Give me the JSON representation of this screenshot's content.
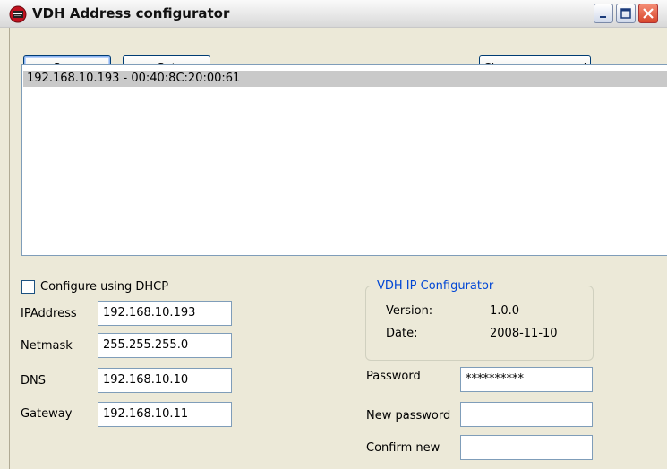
{
  "window": {
    "title": "VDH Address configurator"
  },
  "toolbar": {
    "scan_label": "Scan",
    "set_label": "Set",
    "change_password_label": "Change password"
  },
  "devices": [
    "192.168.10.193 - 00:40:8C:20:00:61"
  ],
  "network": {
    "dhcp_label": "Configure using DHCP",
    "dhcp_checked": false,
    "ip_label": "IPAddress",
    "ip_value": "192.168.10.193",
    "netmask_label": "Netmask",
    "netmask_value": "255.255.255.0",
    "dns_label": "DNS",
    "dns_value": "192.168.10.10",
    "gateway_label": "Gateway",
    "gateway_value": "192.168.10.11"
  },
  "about": {
    "title": "VDH IP Configurator",
    "version_label": "Version:",
    "version_value": "1.0.0",
    "date_label": "Date:",
    "date_value": "2008-11-10"
  },
  "password": {
    "password_label": "Password",
    "password_value": "**********",
    "new_label": "New password",
    "new_value": "",
    "confirm_label": "Confirm new",
    "confirm_value": ""
  },
  "colors": {
    "accent": "#0046d5",
    "selection": "#c9c9c9",
    "close": "#d8462b"
  }
}
